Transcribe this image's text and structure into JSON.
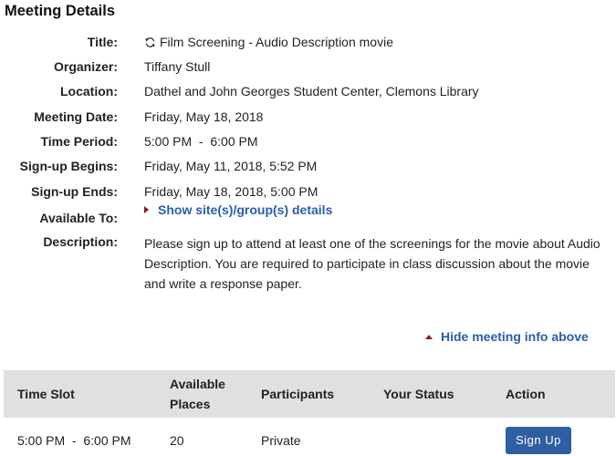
{
  "page": {
    "title": "Meeting Details"
  },
  "details": {
    "title_label": "Title:",
    "title_value": "Film Screening - Audio Description movie",
    "organizer_label": "Organizer:",
    "organizer_value": "Tiffany Stull",
    "location_label": "Location:",
    "location_value": "Dathel and John Georges Student Center, Clemons Library",
    "date_label": "Meeting Date:",
    "date_value": "Friday, May 18, 2018",
    "time_label": "Time Period:",
    "time_value": "5:00 PM  -  6:00 PM",
    "signup_begins_label": "Sign-up Begins:",
    "signup_begins_value": "Friday, May 11, 2018, 5:52 PM",
    "signup_ends_label": "Sign-up Ends:",
    "signup_ends_value": "Friday, May 18, 2018, 5:00 PM",
    "available_label": "Available To:",
    "available_link": "Show site(s)/group(s) details",
    "description_label": "Description:",
    "description_value": "Please sign up to attend at least one of the screenings for the movie about Audio Description.  You are required to participate in class discussion about the movie and write a response paper."
  },
  "hide_link": "Hide meeting info above",
  "table": {
    "headers": {
      "time_slot": "Time Slot",
      "available_line1": "Available",
      "available_line2": "Places",
      "participants": "Participants",
      "your_status": "Your Status",
      "action": "Action"
    },
    "rows": [
      {
        "time_slot": "5:00 PM  -  6:00 PM",
        "available": "20",
        "participants": "Private",
        "your_status": "",
        "action": "Sign Up"
      }
    ]
  },
  "colors": {
    "link": "#2a5db0",
    "button": "#2f5fa3",
    "header_bg": "#e0e0e0",
    "marker": "#8b1a1a"
  },
  "icons": {
    "title_icon": "sync-icon",
    "expand_marker": "triangle-right-icon",
    "collapse_marker": "triangle-up-icon"
  }
}
